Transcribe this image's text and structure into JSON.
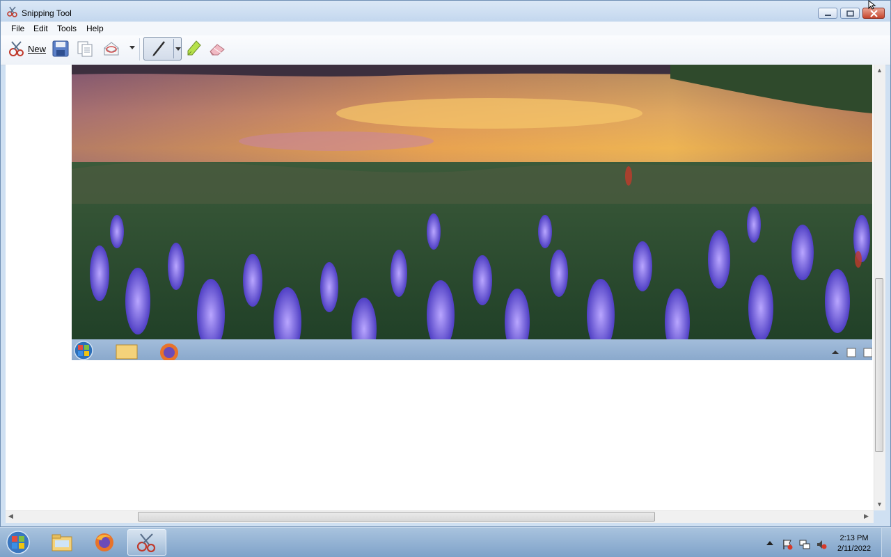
{
  "window": {
    "title": "Snipping Tool"
  },
  "menu": {
    "items": [
      "File",
      "Edit",
      "Tools",
      "Help"
    ]
  },
  "toolbar": {
    "new_label": "New"
  },
  "icons": {
    "app": "scissors-icon",
    "new": "new-snip-icon",
    "save": "save-icon",
    "copy": "copy-icon",
    "send": "send-snip-icon",
    "pen": "pen-icon",
    "highlighter": "highlighter-icon",
    "eraser": "eraser-icon"
  },
  "taskbar": {
    "time": "2:13 PM",
    "date": "2/11/2022"
  },
  "colors": {
    "accent": "#3f6fa8",
    "taskbar": "#8fb0d4"
  }
}
